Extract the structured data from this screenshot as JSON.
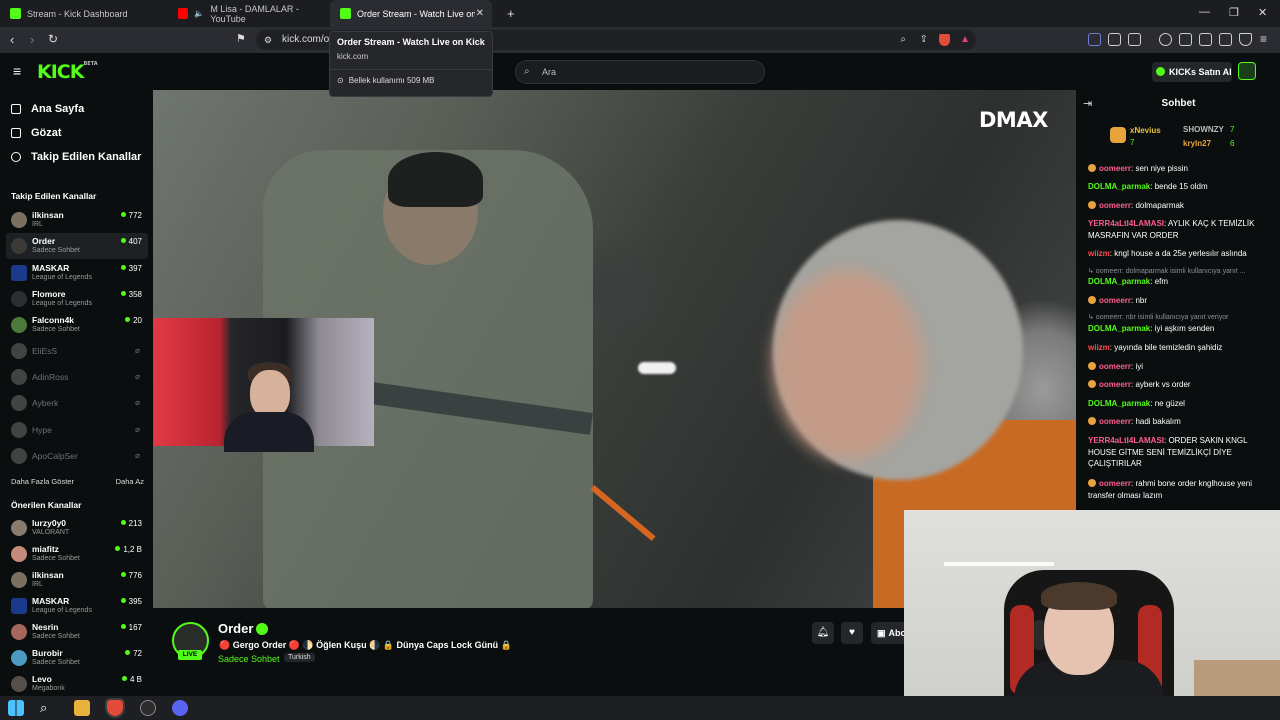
{
  "browser": {
    "tabs": [
      {
        "label": "Stream - Kick Dashboard",
        "icon": "kick-icon"
      },
      {
        "label": "M Lisa - DAMLALAR - YouTube",
        "icon": "youtube-icon"
      },
      {
        "label": "Order Stream - Watch Live on Ki",
        "icon": "kick-icon",
        "active": true
      }
    ],
    "url": "kick.com/o",
    "tooltip": {
      "title": "Order Stream - Watch Live on Kick",
      "domain": "kick.com",
      "memory": "Bellek kullanımı 509 MB"
    }
  },
  "header": {
    "logo": "KICK",
    "logo_sup": "BETA",
    "search_placeholder": "Ara",
    "kicks_button": "KICKs Satın Al"
  },
  "sidebar": {
    "nav": [
      {
        "label": "Ana Sayfa",
        "icon": "home-icon"
      },
      {
        "label": "Gözat",
        "icon": "browse-icon"
      },
      {
        "label": "Takip Edilen Kanallar",
        "icon": "heart-icon"
      }
    ],
    "followed_title": "Takip Edilen Kanallar",
    "followed": [
      {
        "name": "ilkinsan",
        "category": "IRL",
        "viewers": "772"
      },
      {
        "name": "Order",
        "category": "Sadece Sohbet",
        "viewers": "407"
      },
      {
        "name": "MASKAR",
        "category": "League of Legends",
        "viewers": "397"
      },
      {
        "name": "Flomore",
        "category": "League of Legends",
        "viewers": "358"
      },
      {
        "name": "Falconn4k",
        "category": "Sadece Sohbet",
        "viewers": "20"
      },
      {
        "name": "EliEsS"
      },
      {
        "name": "AdinRoss"
      },
      {
        "name": "Ayberk"
      },
      {
        "name": "Hype"
      },
      {
        "name": "ApoCalpSer"
      }
    ],
    "show_more": "Daha Fazla Göster",
    "show_less": "Daha Az",
    "recommended_title": "Önerilen Kanallar",
    "recommended": [
      {
        "name": "lurzy0y0",
        "category": "VALORANT",
        "viewers": "213"
      },
      {
        "name": "miafitz",
        "category": "Sadece Sohbet",
        "viewers": "1,2 B"
      },
      {
        "name": "ilkinsan",
        "category": "IRL",
        "viewers": "776"
      },
      {
        "name": "MASKAR",
        "category": "League of Legends",
        "viewers": "395"
      },
      {
        "name": "Nesrin",
        "category": "Sadece Sohbet",
        "viewers": "167"
      },
      {
        "name": "Burobir",
        "category": "Sadece Sohbet",
        "viewers": "72"
      },
      {
        "name": "Levo",
        "category": "Megabonk",
        "viewers": "4 B"
      }
    ]
  },
  "video": {
    "watermark": "DMAX"
  },
  "streamer": {
    "name": "Order",
    "live": "LIVE",
    "title": "🔴 Gergo Order 🔴 🌓 Öğlen Kuşu 🌗 🔒 Dünya Caps Lock Günü 🔒",
    "category": "Sadece Sohbet",
    "language": "Turkish",
    "subscribe_label": "Abo"
  },
  "chat": {
    "title": "Sohbet",
    "pinned": [
      {
        "name": "xNevius",
        "count": "7"
      },
      {
        "name": "SHOWNZY",
        "count": "7"
      },
      {
        "name": "kryln27",
        "count": "6"
      }
    ],
    "messages": [
      {
        "user": "oomeerr",
        "color": "pink",
        "text": ": sen niye pissin",
        "badge": true
      },
      {
        "user": "DOLMA_parmak",
        "color": "green",
        "text": ": bende 15 oldm"
      },
      {
        "user": "oomeerr",
        "color": "pink",
        "text": ": dolmaparmak",
        "badge": true
      },
      {
        "user": "YERR4aLtI4LAMASI",
        "color": "pink",
        "text": ": AYLIK KAÇ K TEMİZLİK MASRAFIN VAR ORDER"
      },
      {
        "user": "wiizm",
        "color": "red",
        "text": ": kngl house a da 25e yerlesılır aslında"
      },
      {
        "reply": "↳ oomeerr: dolmaparmak isimli kullanıcıya yanıt ..."
      },
      {
        "user": "DOLMA_parmak",
        "color": "green",
        "text": ": efm"
      },
      {
        "user": "oomeerr",
        "color": "pink",
        "text": ": nbr",
        "badge": true
      },
      {
        "reply": "↳ oomeerr: nbr isimli kullanıcıya yanıt veriyor"
      },
      {
        "user": "DOLMA_parmak",
        "color": "green",
        "text": ": iyi aşkım senden"
      },
      {
        "user": "wiizm",
        "color": "red",
        "text": ": yayında bile temizledin şahidiz"
      },
      {
        "user": "oomeerr",
        "color": "pink",
        "text": ": iyi",
        "badge": true
      },
      {
        "user": "oomeerr",
        "color": "pink",
        "text": ": ayberk vs order",
        "badge": true
      },
      {
        "user": "DOLMA_parmak",
        "color": "green",
        "text": ": ne güzel"
      },
      {
        "user": "oomeerr",
        "color": "pink",
        "text": ": hadi bakalım",
        "badge": true
      },
      {
        "user": "YERR4aLtI4LAMASI",
        "color": "pink",
        "text": ": ORDER SAKIN KNGL HOUSE GİTME SENİ TEMİZLİKÇİ DİYE ÇALIŞTIRILAR"
      },
      {
        "user": "oomeerr",
        "color": "pink",
        "text": ": rahmi bone order knglhouse yeni transfer olması lazım",
        "badge": true
      }
    ]
  },
  "colors": {
    "accent": "#53fc18",
    "background": "#0b0e0f"
  }
}
